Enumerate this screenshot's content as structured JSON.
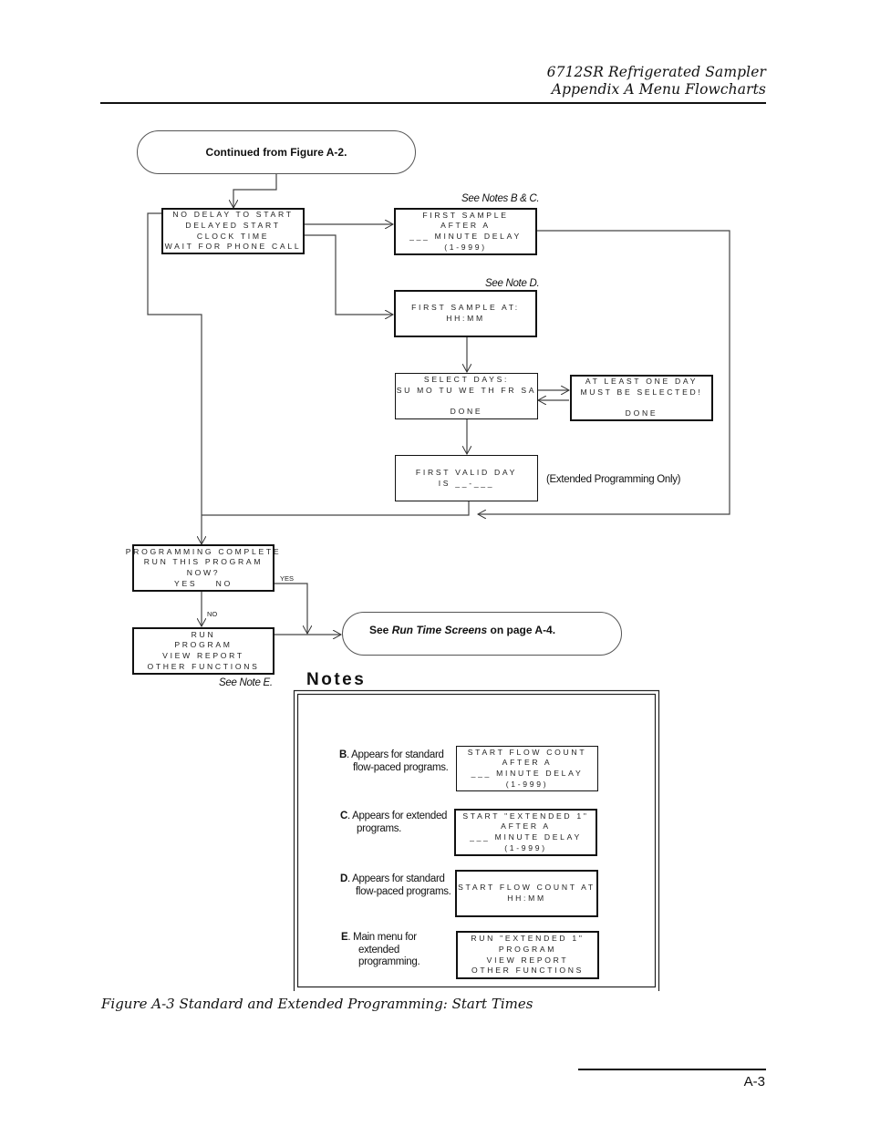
{
  "header": {
    "line1": "6712SR Refrigerated Sampler",
    "line2": "Appendix A  Menu Flowcharts"
  },
  "terminals": {
    "start": "Continued from Figure A-2.",
    "end_prefix": "See ",
    "end_italic": "Run Time Screens",
    "end_suffix": " on page A-4."
  },
  "screens": {
    "start_menu": [
      "NO DELAY TO START",
      "DELAYED START",
      "CLOCK TIME",
      "WAIT FOR PHONE CALL"
    ],
    "first_sample_delay": [
      "FIRST SAMPLE",
      "AFTER A",
      "___ MINUTE DELAY",
      "(1-999)"
    ],
    "first_sample_at": [
      "FIRST SAMPLE AT:",
      "HH:MM"
    ],
    "select_days": [
      "SELECT DAYS:",
      "SU MO TU WE TH FR SA",
      "",
      "DONE"
    ],
    "at_least_one_day": [
      "AT LEAST ONE DAY",
      "MUST BE SELECTED!",
      "",
      "DONE"
    ],
    "first_valid_day": [
      "FIRST VALID DAY",
      "IS __-___"
    ],
    "programming_complete": [
      "PROGRAMMING COMPLETE",
      "RUN THIS PROGRAM",
      "NOW?",
      "YES    NO"
    ],
    "main_menu": [
      "RUN",
      "PROGRAM",
      "VIEW REPORT",
      "OTHER FUNCTIONS"
    ]
  },
  "annotations": {
    "see_notes_bc": "See Notes B & C.",
    "see_note_d": "See Note D.",
    "see_note_e": "See Note E.",
    "extended_only": "(Extended Programming Only)",
    "yes_label": "YES",
    "no_label": "NO"
  },
  "notes": {
    "title": "Notes",
    "items": [
      {
        "letter": "B",
        "text_line1": ". Appears for standard",
        "text_line2": "flow-paced programs.",
        "screen": [
          "START FLOW COUNT",
          "AFTER A",
          "___ MINUTE DELAY",
          "(1-999)"
        ]
      },
      {
        "letter": "C",
        "text_line1": ". Appears for extended",
        "text_line2": "programs.",
        "screen": [
          "START \"EXTENDED 1\"",
          "AFTER A",
          "___ MINUTE DELAY",
          "(1-999)"
        ]
      },
      {
        "letter": "D",
        "text_line1": ". Appears for standard",
        "text_line2": "flow-paced programs.",
        "screen": [
          "START FLOW COUNT AT",
          "HH:MM"
        ]
      },
      {
        "letter": "E",
        "text_line1": ". Main menu for",
        "text_line2": "extended",
        "text_line3": "programming.",
        "screen": [
          "RUN \"EXTENDED 1\"",
          "PROGRAM",
          "VIEW REPORT",
          "OTHER FUNCTIONS"
        ]
      }
    ]
  },
  "caption": "Figure A-3  Standard and Extended Programming: Start Times",
  "page_number": "A-3"
}
